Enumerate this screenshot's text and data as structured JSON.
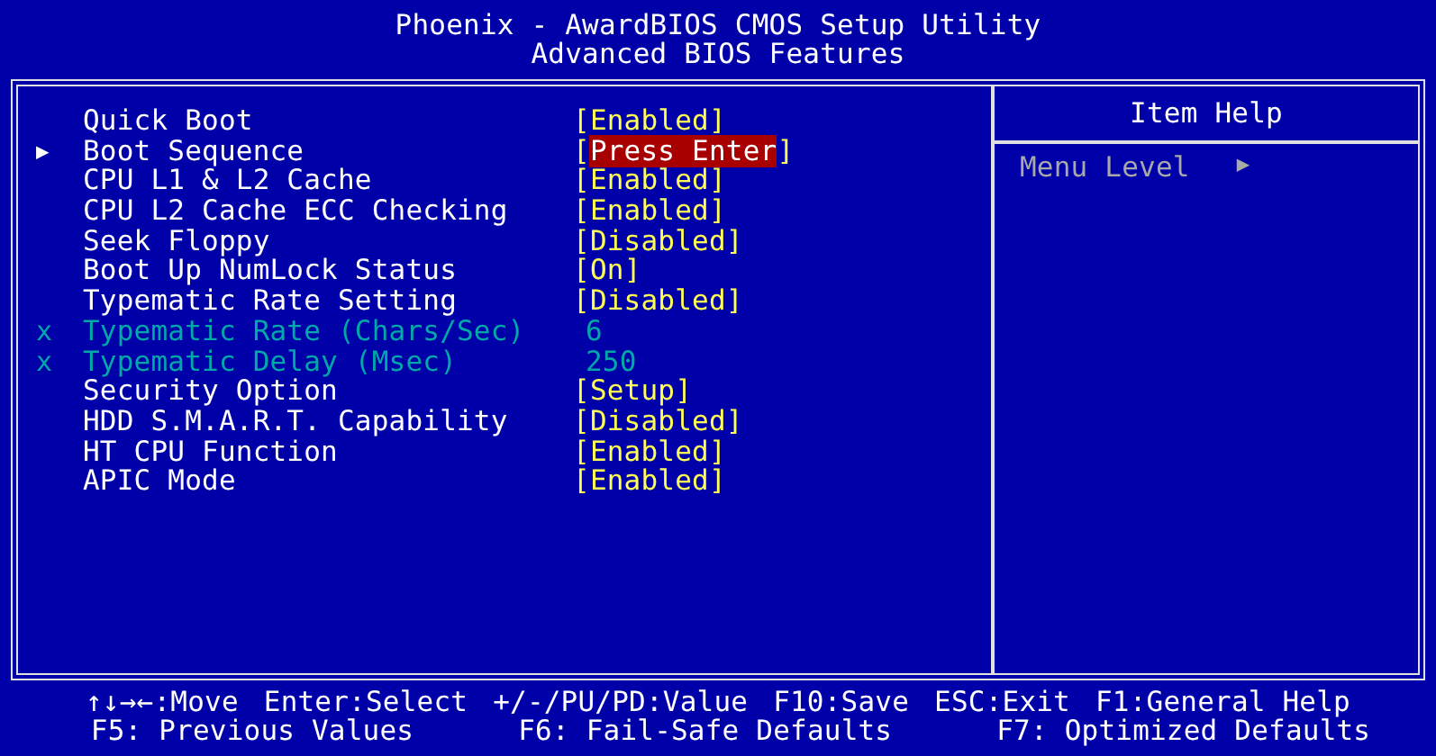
{
  "header": {
    "title": "Phoenix - AwardBIOS CMOS Setup Utility",
    "subtitle": "Advanced BIOS Features"
  },
  "settings": [
    {
      "kind": "setting",
      "label": "Quick Boot",
      "value": "Enabled",
      "brackets": [
        "[",
        "]"
      ],
      "selected": false
    },
    {
      "kind": "submenu",
      "marker": "▶",
      "label": "Boot Sequence",
      "value": "Press Enter",
      "brackets": [
        "[",
        "]"
      ],
      "selected": true
    },
    {
      "kind": "setting",
      "label": "CPU L1 & L2 Cache",
      "value": "Enabled",
      "brackets": [
        "[",
        "]"
      ],
      "selected": false
    },
    {
      "kind": "setting",
      "label": "CPU L2 Cache ECC Checking",
      "value": "Enabled",
      "brackets": [
        "[",
        "]"
      ],
      "selected": false
    },
    {
      "kind": "setting",
      "label": "Seek Floppy",
      "value": "Disabled",
      "brackets": [
        "[",
        "]"
      ],
      "selected": false
    },
    {
      "kind": "setting",
      "label": "Boot Up NumLock Status",
      "value": "On",
      "brackets": [
        "[",
        "]"
      ],
      "selected": false
    },
    {
      "kind": "setting",
      "label": "Typematic Rate Setting",
      "value": "Disabled",
      "brackets": [
        "[",
        "]"
      ],
      "selected": false
    },
    {
      "kind": "locked",
      "marker": "x",
      "label": "Typematic Rate (Chars/Sec)",
      "value": "6",
      "selected": false
    },
    {
      "kind": "locked",
      "marker": "x",
      "label": "Typematic Delay (Msec)",
      "value": "250",
      "selected": false
    },
    {
      "kind": "setting",
      "label": "Security Option",
      "value": "Setup",
      "brackets": [
        "[",
        "]"
      ],
      "selected": false
    },
    {
      "kind": "setting",
      "label": "HDD S.M.A.R.T. Capability",
      "value": "Disabled",
      "brackets": [
        "[",
        "]"
      ],
      "selected": false
    },
    {
      "kind": "setting",
      "label": "HT CPU Function",
      "value": "Enabled",
      "brackets": [
        "[",
        "]"
      ],
      "selected": false
    },
    {
      "kind": "setting",
      "label": "APIC Mode",
      "value": "Enabled",
      "brackets": [
        "[",
        "]"
      ],
      "selected": false
    }
  ],
  "help": {
    "title": "Item Help",
    "menu_level": "Menu Level",
    "menu_level_marker": "▶"
  },
  "footer": [
    [
      "↑↓→←:Move",
      "Enter:Select",
      "+/-/PU/PD:Value",
      "F10:Save",
      "ESC:Exit",
      "F1:General Help"
    ],
    [
      "F5: Previous Values",
      "F6: Fail-Safe Defaults",
      "F7: Optimized Defaults"
    ]
  ]
}
